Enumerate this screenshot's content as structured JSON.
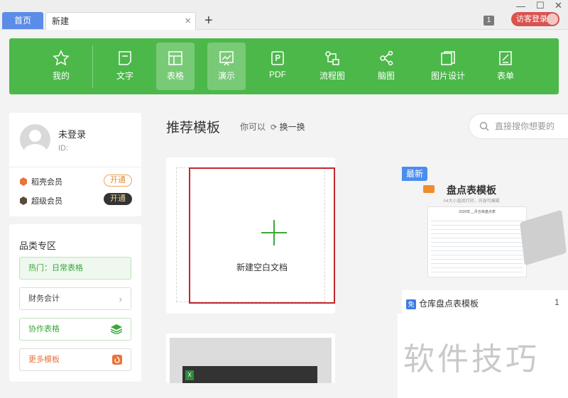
{
  "tabs": {
    "home": "首页",
    "new": "新建",
    "close": "×",
    "add": "+"
  },
  "window": {
    "minimize": "—",
    "maximize": "☐",
    "close": "✕"
  },
  "header": {
    "badge_count": "1",
    "visitor_login": "访客登录"
  },
  "toolbar": {
    "items": [
      {
        "label": "我的",
        "icon": "star-icon",
        "active": false
      },
      {
        "label": "文字",
        "icon": "text-doc-icon",
        "active": false
      },
      {
        "label": "表格",
        "icon": "table-icon",
        "active": true
      },
      {
        "label": "演示",
        "icon": "presentation-icon",
        "active": true
      },
      {
        "label": "PDF",
        "icon": "pdf-icon",
        "active": false
      },
      {
        "label": "流程图",
        "icon": "flowchart-icon",
        "active": false
      },
      {
        "label": "脑图",
        "icon": "mindmap-icon",
        "active": false
      },
      {
        "label": "图片设计",
        "icon": "image-design-icon",
        "active": false
      },
      {
        "label": "表单",
        "icon": "form-icon",
        "active": false
      }
    ]
  },
  "user": {
    "status": "未登录",
    "id_label": "ID:"
  },
  "membership": [
    {
      "name": "稻壳会员",
      "button": "开通"
    },
    {
      "name": "超级会员",
      "button": "开通"
    }
  ],
  "categories": {
    "title": "品类专区",
    "items": [
      {
        "label": "热门：日常表格"
      },
      {
        "label": "财务会计"
      },
      {
        "label": "协作表格"
      },
      {
        "label": "更多模板"
      }
    ]
  },
  "main": {
    "title": "推荐模板",
    "hint": "你可以",
    "refresh": "换一换",
    "search_placeholder": "直接搜你想要的",
    "blank": {
      "label": "新建空白文档"
    },
    "template": {
      "badge": "最新",
      "heading": "盘点表模板",
      "subheading": "A4大小直接打印，内容可编辑",
      "sheet_title": "2020年__月仓库盘点表",
      "free_icon": "免",
      "name": "仓库盘点表模板",
      "count": "1"
    }
  },
  "watermark": "软件技巧",
  "colors": {
    "toolbar_green": "#4cb84a",
    "home_tab_blue": "#5b8ce8",
    "visitor_red": "#d9534f",
    "highlight_red": "#c1272d"
  }
}
